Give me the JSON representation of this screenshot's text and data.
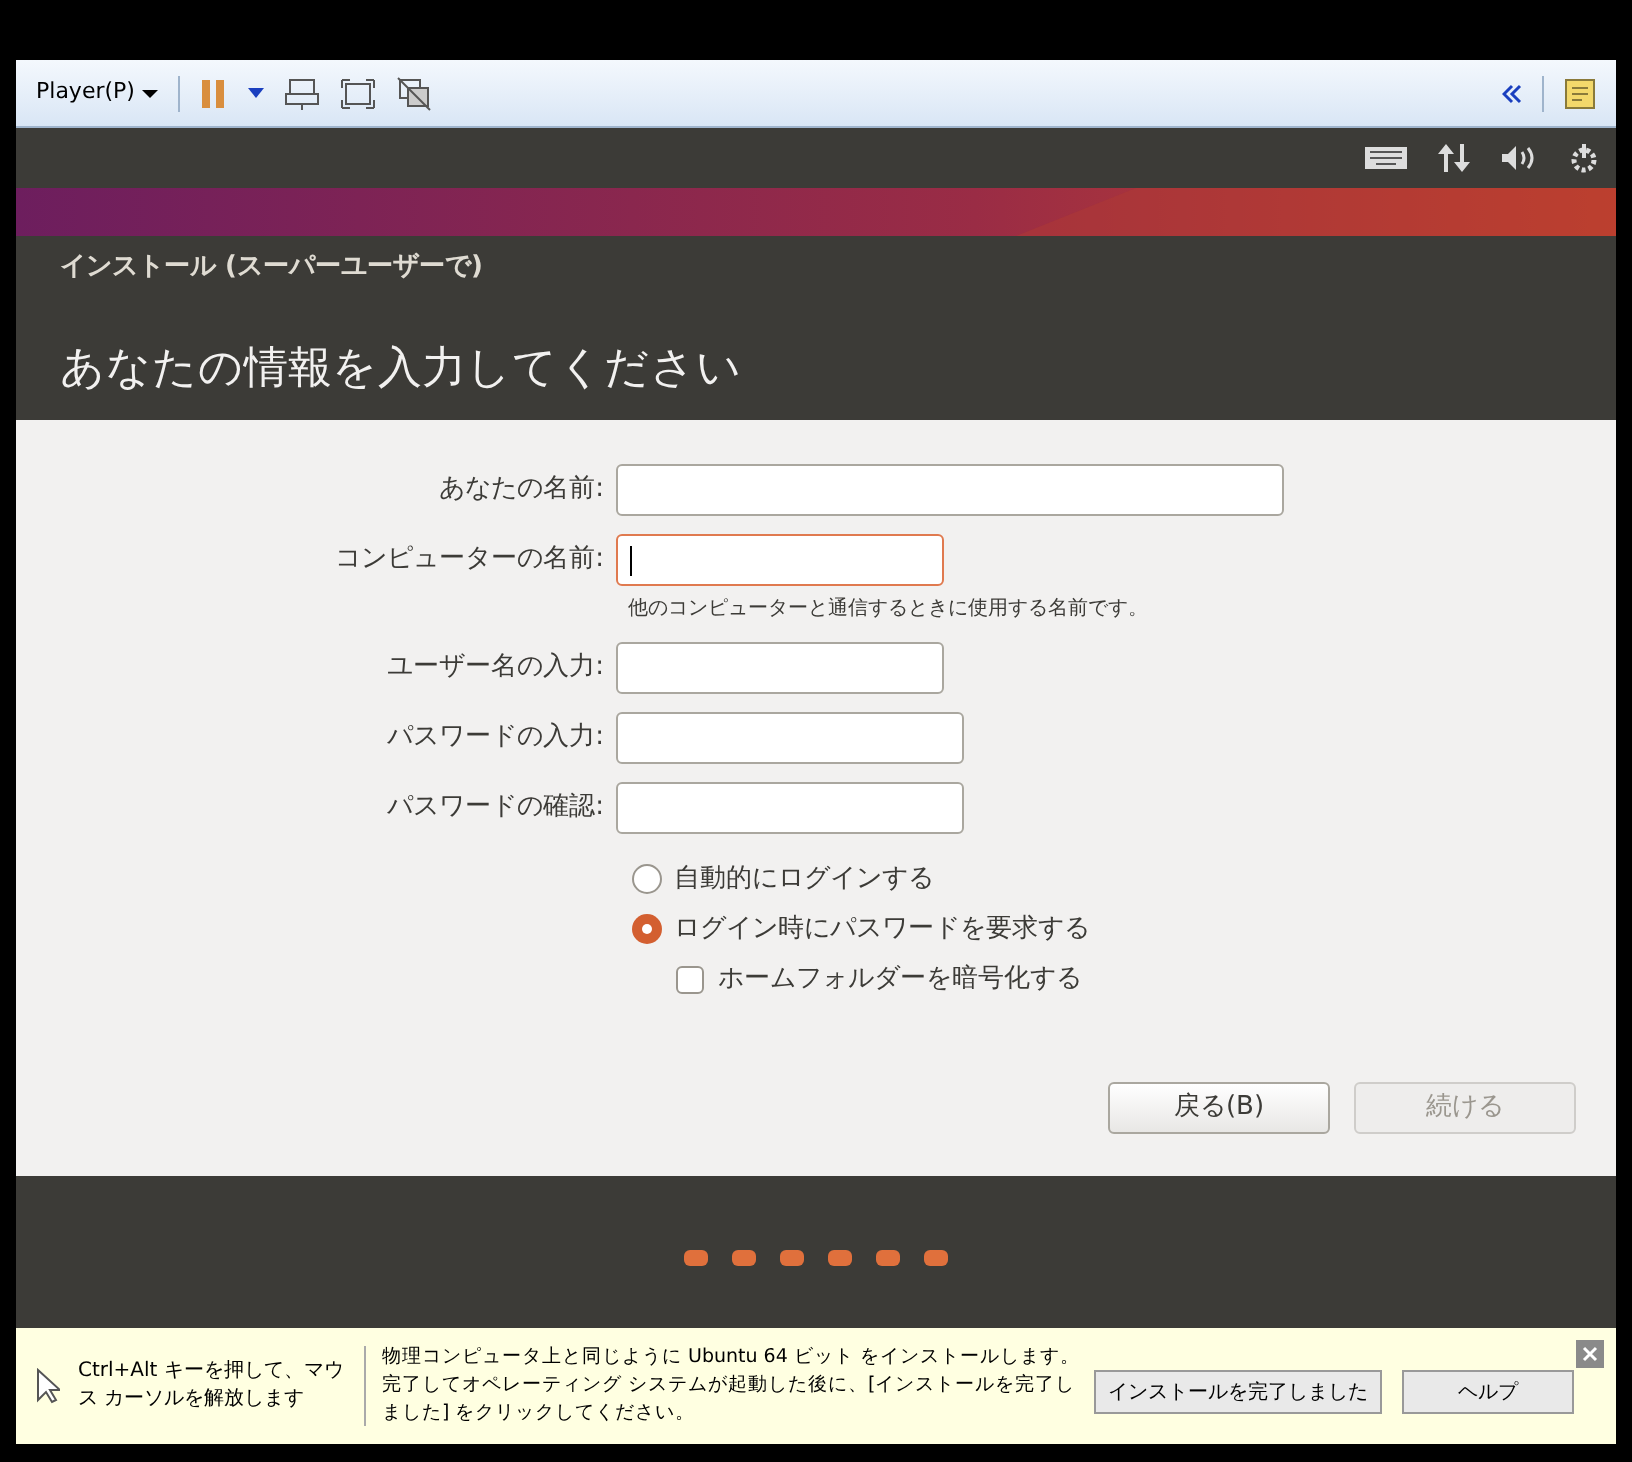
{
  "player_toolbar": {
    "menu": "Player(P)"
  },
  "dialog": {
    "title": "インストール (スーパーユーザーで)",
    "heading": "あなたの情報を入力してください",
    "fields": [
      {
        "label": "あなたの名前:",
        "focused": false
      },
      {
        "label": "コンピューターの名前:",
        "focused": true,
        "hint": "他のコンピューターと通信するときに使用する名前です。"
      },
      {
        "label": "ユーザー名の入力:",
        "focused": false
      },
      {
        "label": "パスワードの入力:",
        "focused": false
      },
      {
        "label": "パスワードの確認:",
        "focused": false
      }
    ],
    "login_options": [
      {
        "label": "自動的にログインする",
        "selected": false
      },
      {
        "label": "ログイン時にパスワードを要求する",
        "selected": true
      }
    ],
    "encrypt_home": {
      "label": "ホームフォルダーを暗号化する",
      "checked": false
    },
    "buttons": [
      {
        "label": "戻る(B)",
        "disabled": false
      },
      {
        "label": "続ける",
        "disabled": true
      }
    ]
  },
  "info_bar": {
    "hint": "Ctrl+Alt キーを押して、マウス カーソルを解放します",
    "message": "物理コンピュータ上と同じように Ubuntu 64 ビット をインストールします。完了してオペレーティング システムが起動した後に、[インストールを完了しました] をクリックしてください。",
    "buttons": [
      "インストールを完了しました",
      "ヘルプ"
    ]
  }
}
